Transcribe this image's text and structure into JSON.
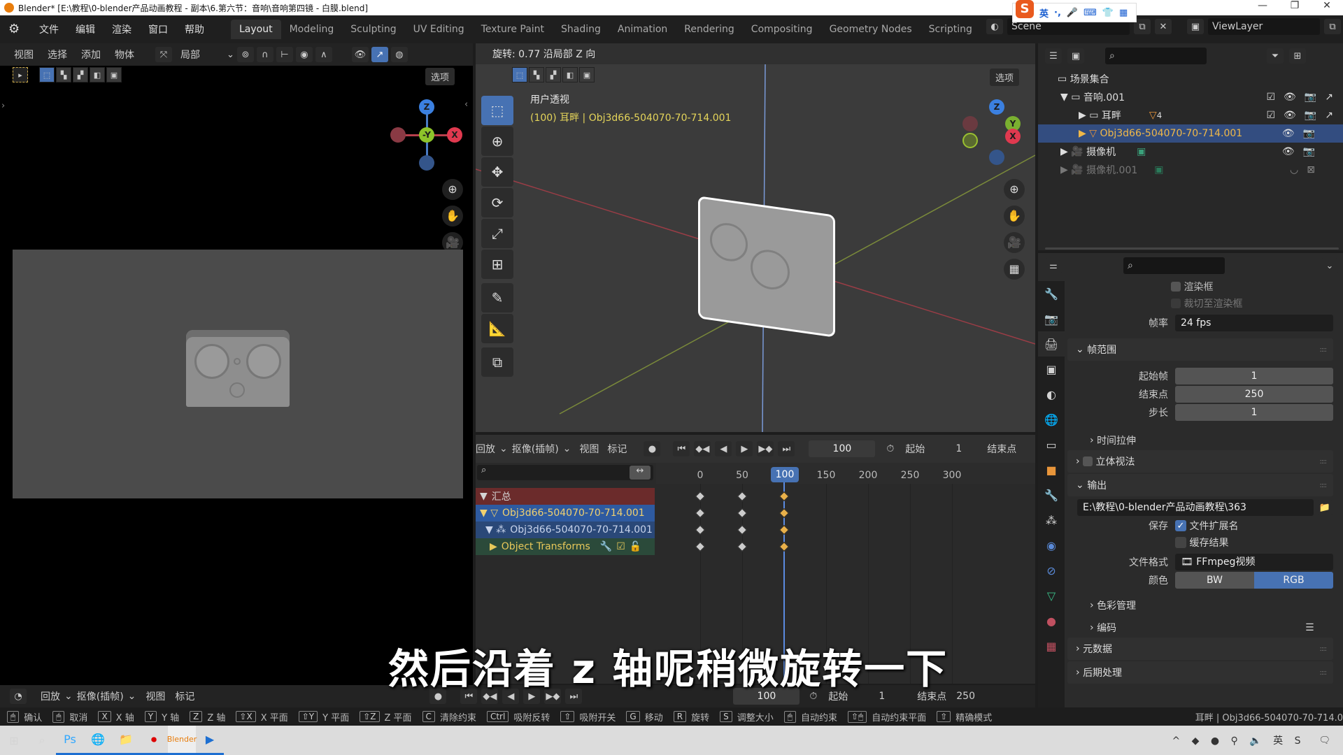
{
  "window": {
    "title": "Blender* [E:\\教程\\0-blender产品动画教程 - 副本\\6.第六节：音响\\音响第四镜 - 白膜.blend]",
    "controls": [
      "—",
      "❐",
      "✕"
    ]
  },
  "ime": {
    "lang": "英",
    "items": [
      "·,",
      "🎤",
      "⌨",
      "👕",
      "▦"
    ]
  },
  "menu": {
    "items": [
      "文件",
      "编辑",
      "渲染",
      "窗口",
      "帮助"
    ]
  },
  "workspaces": {
    "tabs": [
      "Layout",
      "Modeling",
      "Sculpting",
      "UV Editing",
      "Texture Paint",
      "Shading",
      "Animation",
      "Rendering",
      "Compositing",
      "Geometry Nodes",
      "Scripting"
    ],
    "active": "Layout",
    "add": "+"
  },
  "scene": {
    "name": "Scene",
    "view_layer": "ViewLayer"
  },
  "left_viewport": {
    "header": [
      "视图",
      "选择",
      "添加",
      "物体"
    ],
    "transform_orientation": "局部",
    "options_label": "选项",
    "gizmo": {
      "z": "Z",
      "y": "-Y",
      "x": "X"
    }
  },
  "viewport3d": {
    "operator_status": "旋转: 0.77 沿局部 Z 向",
    "view_name": "用户透视",
    "object_info": "(100) 耳畔 | Obj3d66-504070-70-714.001",
    "options_label": "选项",
    "gizmo": {
      "z": "Z",
      "y": "Y",
      "x": "X"
    },
    "tools": [
      "select-box",
      "cursor",
      "move",
      "rotate",
      "scale",
      "transform",
      "annotate",
      "measure",
      "add-cube"
    ]
  },
  "dopesheet": {
    "header": {
      "mode": "回放",
      "keying": "抠像(插帧)",
      "view": "视图",
      "marker": "标记",
      "current_frame": "100",
      "start_label": "起始",
      "start": "1",
      "end_label": "结束点"
    },
    "frame_ticks": [
      "0",
      "50",
      "100",
      "150",
      "200",
      "250",
      "300"
    ],
    "current_frame_badge": "100",
    "channels": [
      {
        "label": "汇总",
        "type": "summary"
      },
      {
        "label": "Obj3d66-504070-70-714.001",
        "type": "object"
      },
      {
        "label": "Obj3d66-504070-70-714.001",
        "type": "action"
      },
      {
        "label": "Object Transforms",
        "type": "group"
      }
    ],
    "keyframes": [
      0,
      50,
      100
    ]
  },
  "outliner": {
    "search_placeholder": "",
    "rows": [
      {
        "label": "场景集合",
        "level": 0
      },
      {
        "label": "音响.001",
        "level": 1
      },
      {
        "label": "耳畔",
        "level": 2,
        "badge": "4"
      },
      {
        "label": "Obj3d66-504070-70-714.001",
        "level": 2,
        "selected": true
      },
      {
        "label": "摄像机",
        "level": 1
      },
      {
        "label": "摄像机.001",
        "level": 1,
        "dimmed": true
      }
    ]
  },
  "properties": {
    "render_region": "渲染框",
    "crop_to_region": "裁切至渲染框",
    "fps_label": "帧率",
    "fps": "24 fps",
    "frame_range": {
      "title": "帧范围",
      "start_label": "起始帧",
      "start": "1",
      "end_label": "结束点",
      "end": "250",
      "step_label": "步长",
      "step": "1"
    },
    "time_stretch": "时间拉伸",
    "stereoscopy": "立体视法",
    "output": {
      "title": "输出",
      "path": "E:\\教程\\0-blender产品动画教程\\363",
      "save_label": "保存",
      "file_ext": "文件扩展名",
      "cache_result": "缓存结果",
      "format_label": "文件格式",
      "format": "FFmpeg视频",
      "color_label": "颜色",
      "color_bw": "BW",
      "color_rgb": "RGB",
      "color_management": "色彩管理",
      "encoding": "编码"
    },
    "metadata": "元数据",
    "post_processing": "后期处理"
  },
  "timeline": {
    "mode": "回放",
    "keying": "抠像(插帧)",
    "view": "视图",
    "marker": "标记",
    "current_frame": "100",
    "start_label": "起始",
    "start": "1",
    "end_label": "结束点",
    "end": "250"
  },
  "statusbar": {
    "items": [
      {
        "key": "🖱",
        "label": "确认"
      },
      {
        "key": "🖱",
        "label": "取消"
      },
      {
        "key": "X",
        "label": "X 轴"
      },
      {
        "key": "Y",
        "label": "Y 轴"
      },
      {
        "key": "Z",
        "label": "Z 轴"
      },
      {
        "key": "⇧X",
        "label": "X 平面"
      },
      {
        "key": "⇧Y",
        "label": "Y 平面"
      },
      {
        "key": "⇧Z",
        "label": "Z 平面"
      },
      {
        "key": "C",
        "label": "清除约束"
      },
      {
        "key": "Ctrl",
        "label": "吸附反转"
      },
      {
        "key": "⇧",
        "label": "吸附开关"
      },
      {
        "key": "G",
        "label": "移动"
      },
      {
        "key": "R",
        "label": "旋转"
      },
      {
        "key": "S",
        "label": "调整大小"
      },
      {
        "key": "🖱",
        "label": "自动约束"
      },
      {
        "key": "⇧🖱",
        "label": "自动约束平面"
      },
      {
        "key": "⇧",
        "label": "精确模式"
      }
    ],
    "right": "耳畔 | Obj3d66-504070-70-714.0"
  },
  "subtitle": "然后沿着 z 轴呢稍微旋转一下",
  "taskbar": {
    "apps": [
      "Ps",
      "🌐",
      "📁",
      "⏺",
      "Blender",
      "▶"
    ]
  }
}
